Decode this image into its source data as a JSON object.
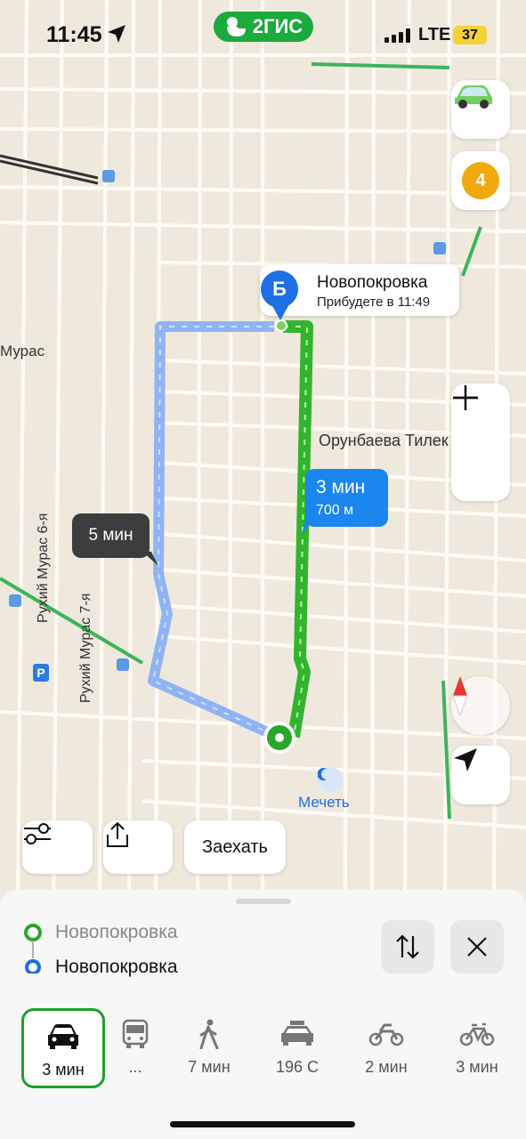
{
  "status_bar": {
    "time": "11:45",
    "network": "LTE",
    "battery": "37"
  },
  "app": {
    "logo_text": "2ГИС",
    "accent": "#1baa3c",
    "route_blue": "#1a86f0"
  },
  "map": {
    "destination": {
      "pin_letter": "Б",
      "name": "Новопокровка",
      "arrival": "Прибудете в 11:49"
    },
    "primary_route": {
      "duration": "3 мин",
      "distance": "700 м"
    },
    "alt_route": {
      "duration": "5 мин"
    },
    "traffic_level": "4",
    "street_labels": [
      "Орунбаева Тилек",
      "Рухий Мурас 6-я",
      "Рухий Мурас 7-я",
      "Мурас"
    ],
    "poi_label": "Мечеть",
    "parking_label": "P"
  },
  "action_bar": {
    "enter_label": "Заехать"
  },
  "route_panel": {
    "from": "Новопокровка",
    "to": "Новопокровка",
    "modes": [
      {
        "icon": "car-icon",
        "label": "3 мин",
        "active": true
      },
      {
        "icon": "bus-icon",
        "label": "...",
        "active": false
      },
      {
        "icon": "walk-icon",
        "label": "7 мин",
        "active": false
      },
      {
        "icon": "taxi-icon",
        "label": "196 С",
        "active": false
      },
      {
        "icon": "motorcycle-icon",
        "label": "2 мин",
        "active": false
      },
      {
        "icon": "bicycle-icon",
        "label": "3 мин",
        "active": false
      }
    ]
  }
}
